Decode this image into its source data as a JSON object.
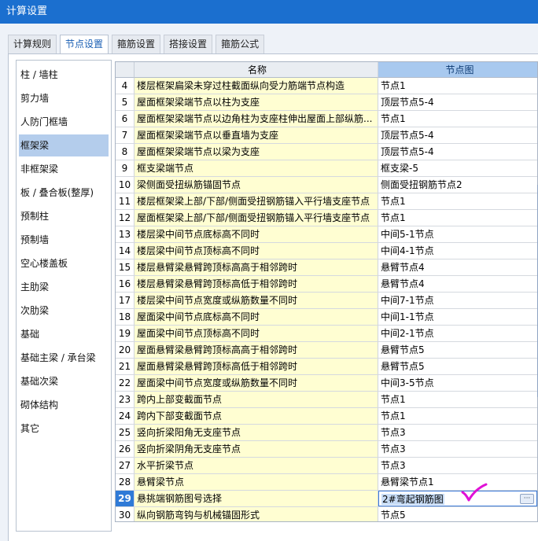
{
  "window": {
    "title": "计算设置"
  },
  "tabs": [
    {
      "label": "计算规则",
      "active": false
    },
    {
      "label": "节点设置",
      "active": true
    },
    {
      "label": "箍筋设置",
      "active": false
    },
    {
      "label": "搭接设置",
      "active": false
    },
    {
      "label": "箍筋公式",
      "active": false
    }
  ],
  "sidebar": {
    "items": [
      "柱 / 墙柱",
      "剪力墙",
      "人防门框墙",
      "框架梁",
      "非框架梁",
      "板 / 叠合板(整厚)",
      "预制柱",
      "预制墙",
      "空心楼盖板",
      "主肋梁",
      "次肋梁",
      "基础",
      "基础主梁 / 承台梁",
      "基础次梁",
      "砌体结构",
      "其它"
    ],
    "selected": "框架梁"
  },
  "table": {
    "headers": {
      "name": "名称",
      "node": "节点图"
    },
    "rows": [
      {
        "num": "4",
        "name": "楼层框架扁梁未穿过柱截面纵向受力筋端节点构造",
        "node": "节点1"
      },
      {
        "num": "5",
        "name": "屋面框架梁端节点以柱为支座",
        "node": "顶层节点5-4"
      },
      {
        "num": "6",
        "name": "屋面框架梁端节点以边角柱为支座柱伸出屋面上部纵筋...",
        "node": "节点1"
      },
      {
        "num": "7",
        "name": "屋面框架梁端节点以垂直墙为支座",
        "node": "顶层节点5-4"
      },
      {
        "num": "8",
        "name": "屋面框架梁端节点以梁为支座",
        "node": "顶层节点5-4"
      },
      {
        "num": "9",
        "name": "框支梁端节点",
        "node": "框支梁-5"
      },
      {
        "num": "10",
        "name": "梁侧面受扭纵筋锚固节点",
        "node": "侧面受扭钢筋节点2"
      },
      {
        "num": "11",
        "name": "楼层框架梁上部/下部/侧面受扭钢筋锚入平行墙支座节点",
        "node": "节点1"
      },
      {
        "num": "12",
        "name": "屋面框架梁上部/下部/侧面受扭钢筋锚入平行墙支座节点",
        "node": "节点1"
      },
      {
        "num": "13",
        "name": "楼层梁中间节点底标高不同时",
        "node": "中间5-1节点"
      },
      {
        "num": "14",
        "name": "楼层梁中间节点顶标高不同时",
        "node": "中间4-1节点"
      },
      {
        "num": "15",
        "name": "楼层悬臂梁悬臂跨顶标高高于相邻跨时",
        "node": "悬臂节点4"
      },
      {
        "num": "16",
        "name": "楼层悬臂梁悬臂跨顶标高低于相邻跨时",
        "node": "悬臂节点4"
      },
      {
        "num": "17",
        "name": "楼层梁中间节点宽度或纵筋数量不同时",
        "node": "中间7-1节点"
      },
      {
        "num": "18",
        "name": "屋面梁中间节点底标高不同时",
        "node": "中间1-1节点"
      },
      {
        "num": "19",
        "name": "屋面梁中间节点顶标高不同时",
        "node": "中间2-1节点"
      },
      {
        "num": "20",
        "name": "屋面悬臂梁悬臂跨顶标高高于相邻跨时",
        "node": "悬臂节点5"
      },
      {
        "num": "21",
        "name": "屋面悬臂梁悬臂跨顶标高低于相邻跨时",
        "node": "悬臂节点5"
      },
      {
        "num": "22",
        "name": "屋面梁中间节点宽度或纵筋数量不同时",
        "node": "中间3-5节点"
      },
      {
        "num": "23",
        "name": "跨内上部变截面节点",
        "node": "节点1"
      },
      {
        "num": "24",
        "name": "跨内下部变截面节点",
        "node": "节点1"
      },
      {
        "num": "25",
        "name": "竖向折梁阳角无支座节点",
        "node": "节点3"
      },
      {
        "num": "26",
        "name": "竖向折梁阴角无支座节点",
        "node": "节点3"
      },
      {
        "num": "27",
        "name": "水平折梁节点",
        "node": "节点3"
      },
      {
        "num": "28",
        "name": "悬臂梁节点",
        "node": "悬臂梁节点1"
      },
      {
        "num": "29",
        "name": "悬挑端钢筋图号选择",
        "node": "2#弯起钢筋图"
      },
      {
        "num": "30",
        "name": "纵向钢筋弯钩与机械锚固形式",
        "node": "节点5"
      }
    ],
    "selected_row": "29",
    "more_button": "···"
  },
  "colors": {
    "titlebar": "#1b6fcf",
    "name_cell_bg": "#fffed2",
    "header_highlight": "#a8c9ef",
    "sidebar_selected": "#b4cdec",
    "checkmark": "#e011d6"
  }
}
